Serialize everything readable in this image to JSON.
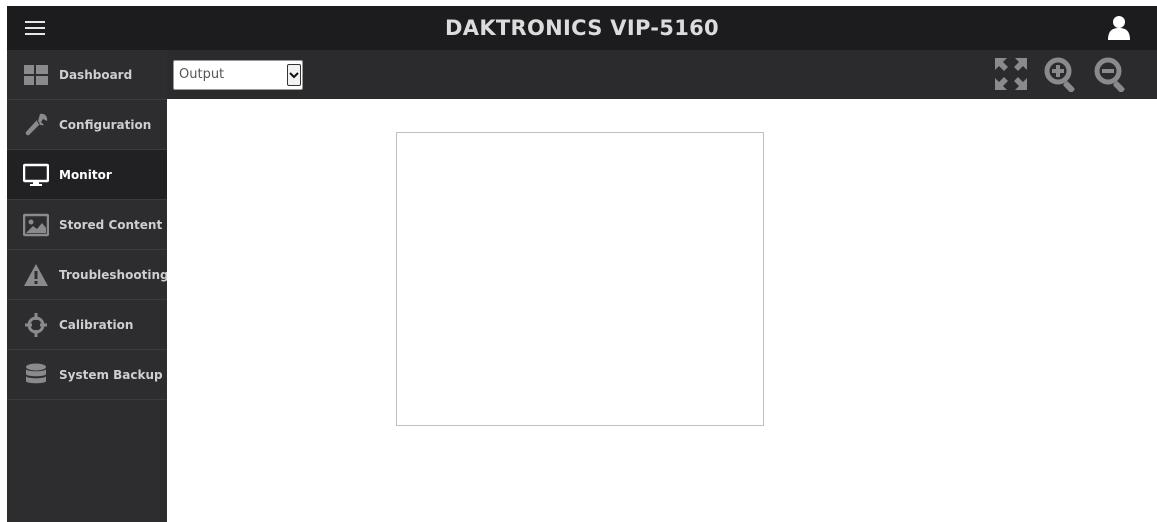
{
  "header": {
    "title": "DAKTRONICS VIP-5160",
    "menu_icon": "hamburger-menu-icon",
    "user_icon": "user-icon"
  },
  "toolbar": {
    "view_select": {
      "value": "Output"
    },
    "icons": [
      "fullscreen-icon",
      "zoom-in-icon",
      "zoom-out-icon"
    ]
  },
  "sidebar": {
    "items": [
      {
        "label": "Dashboard",
        "icon": "dashboard-icon",
        "active": false
      },
      {
        "label": "Configuration",
        "icon": "wrench-icon",
        "active": false
      },
      {
        "label": "Monitor",
        "icon": "monitor-icon",
        "active": true
      },
      {
        "label": "Stored Content",
        "icon": "image-icon",
        "active": false
      },
      {
        "label": "Troubleshooting",
        "icon": "warning-icon",
        "active": false
      },
      {
        "label": "Calibration",
        "icon": "crosshair-icon",
        "active": false
      },
      {
        "label": "System Backup",
        "icon": "database-icon",
        "active": false
      }
    ]
  },
  "colors": {
    "header_bg": "#1c1c1e",
    "sidebar_bg": "#2d2d2f",
    "toolbar_bg": "#2b2b2d",
    "icon_gray": "#8a8a8c"
  }
}
